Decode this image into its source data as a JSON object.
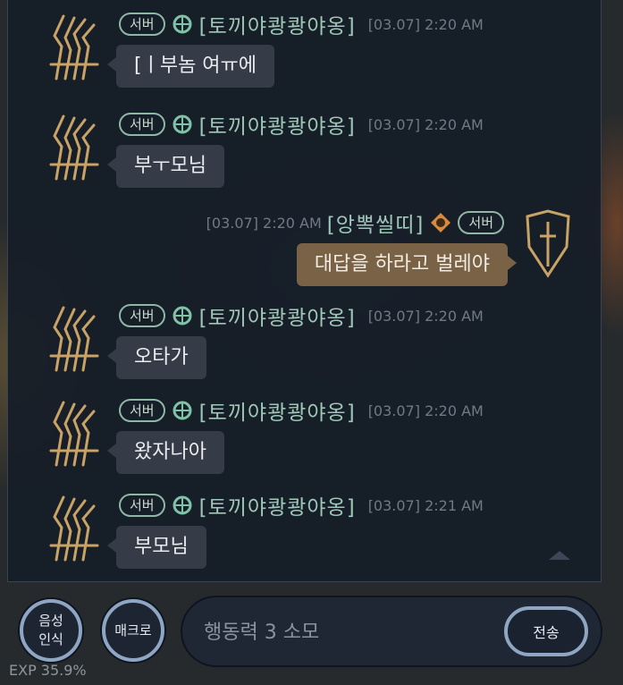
{
  "chat": {
    "messages": [
      {
        "badge": "서버",
        "name": "[토끼야쾅쾅야옹]",
        "time": "[03.07] 2:20 AM",
        "text": "[ㅣ부놈 여ㅠ에",
        "mine": false
      },
      {
        "badge": "서버",
        "name": "[토끼야쾅쾅야옹]",
        "time": "[03.07] 2:20 AM",
        "text": "부ㅜ모님",
        "mine": false
      },
      {
        "badge": "서버",
        "name": "[앙뽁씰띠]",
        "time": "[03.07] 2:20 AM",
        "text": "대답을 하라고 벌레야",
        "mine": true
      },
      {
        "badge": "서버",
        "name": "[토끼야쾅쾅야옹]",
        "time": "[03.07] 2:20 AM",
        "text": "오타가",
        "mine": false
      },
      {
        "badge": "서버",
        "name": "[토끼야쾅쾅야옹]",
        "time": "[03.07] 2:20 AM",
        "text": "왔자나아",
        "mine": false
      },
      {
        "badge": "서버",
        "name": "[토끼야쾅쾅야옹]",
        "time": "[03.07] 2:21 AM",
        "text": "부모님",
        "mine": false
      }
    ]
  },
  "controls": {
    "voice_label": "음성\n인식",
    "macro_label": "매크로",
    "input_placeholder": "행동력 3 소모",
    "send_label": "전송"
  },
  "hud": {
    "exp_text": "EXP 35.9%"
  },
  "colors": {
    "panel_bg": "#161d28",
    "bubble_other": "#363c47",
    "bubble_mine": "#7a6246",
    "name_color": "#9fc7b8",
    "button_ring": "#8fa6c2"
  }
}
